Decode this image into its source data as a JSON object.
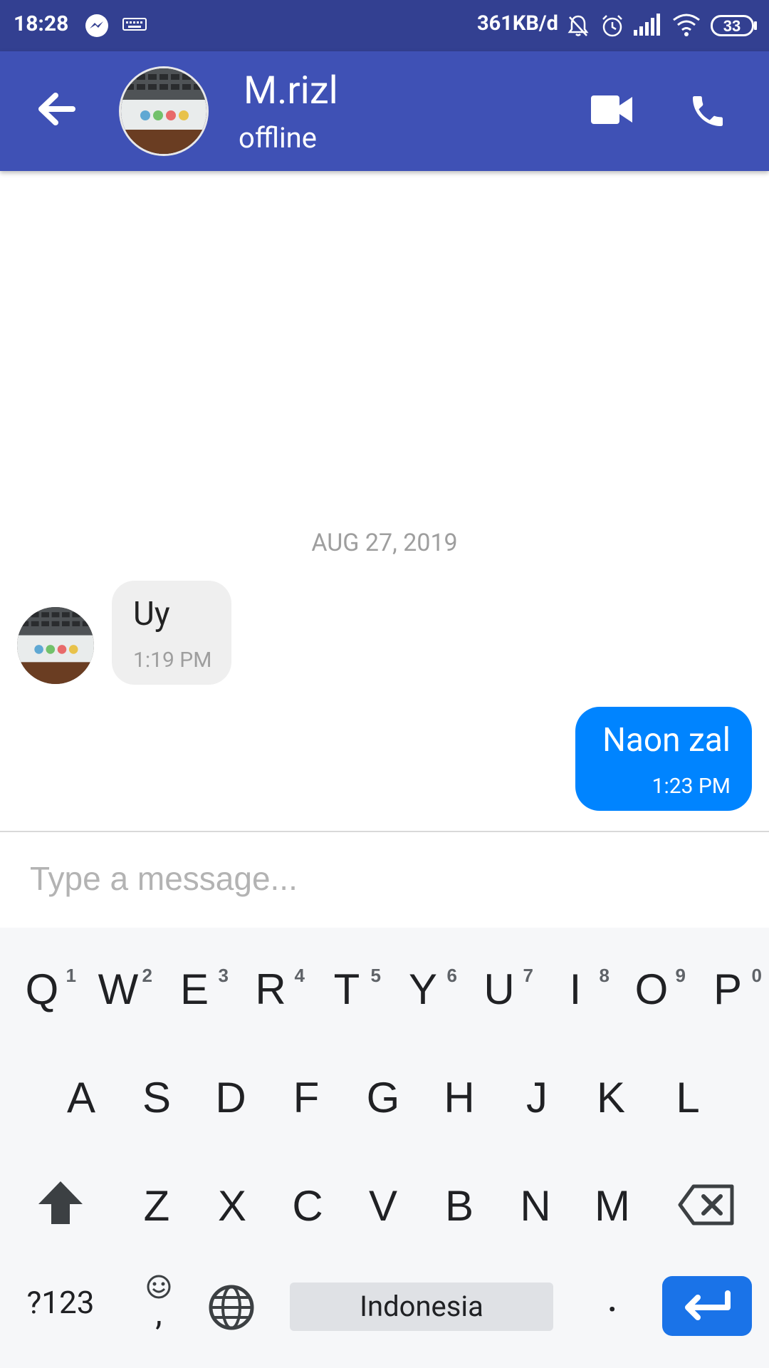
{
  "status_bar": {
    "time": "18:28",
    "speed": "361KB/d",
    "battery": "33"
  },
  "header": {
    "contact_name": "M.rizl",
    "presence": "offline"
  },
  "conversation": {
    "date_separator": "AUG 27, 2019",
    "messages": [
      {
        "direction": "incoming",
        "text": "Uy",
        "time": "1:19 PM"
      },
      {
        "direction": "outgoing",
        "text": "Naon zal",
        "time": "1:23 PM"
      }
    ]
  },
  "composer": {
    "placeholder": "Type a message..."
  },
  "keyboard": {
    "row1": [
      {
        "ch": "Q",
        "num": "1"
      },
      {
        "ch": "W",
        "num": "2"
      },
      {
        "ch": "E",
        "num": "3"
      },
      {
        "ch": "R",
        "num": "4"
      },
      {
        "ch": "T",
        "num": "5"
      },
      {
        "ch": "Y",
        "num": "6"
      },
      {
        "ch": "U",
        "num": "7"
      },
      {
        "ch": "I",
        "num": "8"
      },
      {
        "ch": "O",
        "num": "9"
      },
      {
        "ch": "P",
        "num": "0"
      }
    ],
    "row2": [
      "A",
      "S",
      "D",
      "F",
      "G",
      "H",
      "J",
      "K",
      "L"
    ],
    "row3": [
      "Z",
      "X",
      "C",
      "V",
      "B",
      "N",
      "M"
    ],
    "symbols_label": "?123",
    "emoji_comma": ",",
    "space_label": "Indonesia",
    "period_label": "."
  },
  "colors": {
    "app_bar": "#3f51b5",
    "status_bar": "#334091",
    "outgoing_bubble": "#0084ff",
    "incoming_bubble": "#efefef",
    "enter_key": "#1a73e8"
  }
}
